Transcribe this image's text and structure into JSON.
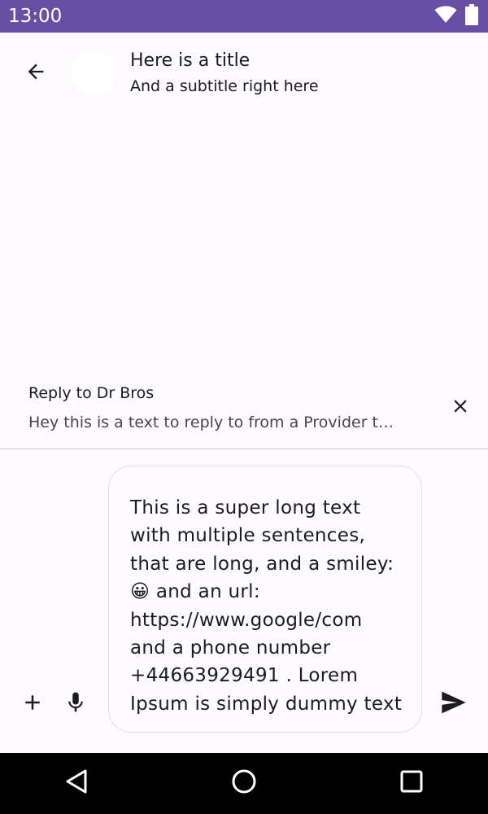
{
  "status_bar": {
    "time": "13:00",
    "icons": [
      "wifi-icon",
      "battery-icon"
    ],
    "color": "#6750a4"
  },
  "app_bar": {
    "back_icon": "arrow-back-icon",
    "title": "Here is a title",
    "subtitle": "And a subtitle right here"
  },
  "reply": {
    "label": "Reply to Dr Bros",
    "preview": "Hey this is a text to reply to from a Provider t…",
    "close_icon": "close-icon"
  },
  "composer": {
    "add_icon": "plus-icon",
    "mic_icon": "microphone-icon",
    "send_icon": "send-icon",
    "message": "This is a super long text\nwith multiple sentences,\nthat are long, and a smiley:\n😀 and an url:\nhttps://www.google/com\nand a phone number\n+44663929491 . Lorem\nIpsum is simply dummy text"
  },
  "nav_bar": {
    "icons": [
      "nav-back-icon",
      "nav-home-icon",
      "nav-recents-icon"
    ]
  }
}
